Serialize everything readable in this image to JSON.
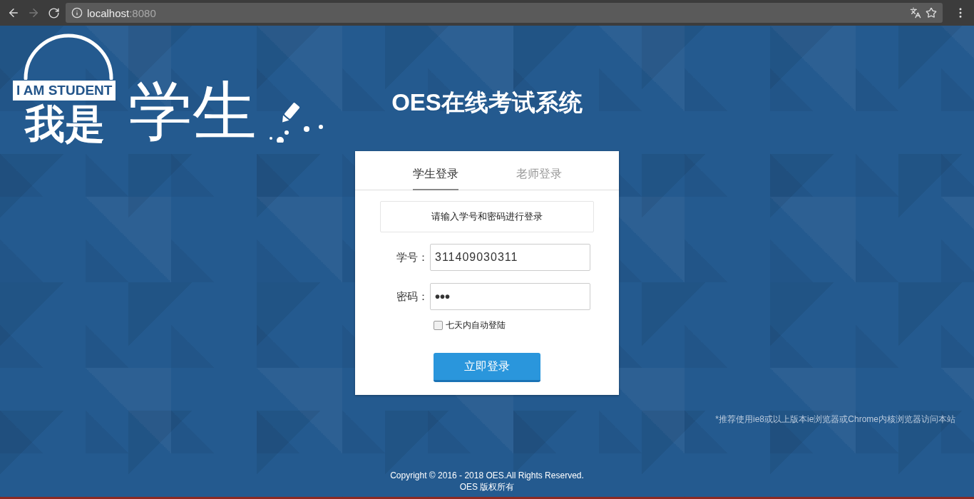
{
  "browser": {
    "url_host": "localhost",
    "url_port": ":8080"
  },
  "logo": {
    "badge": "I AM STUDENT",
    "line_bold": "我是",
    "line_light": "学生"
  },
  "title": "OES在线考试系统",
  "login": {
    "tabs": [
      {
        "label": "学生登录",
        "selected": true
      },
      {
        "label": "老师登录",
        "selected": false
      }
    ],
    "notice": "请输入学号和密码进行登录",
    "fields": [
      {
        "label": "学号：",
        "value": "311409030311",
        "kind": "text"
      },
      {
        "label": "密码：",
        "value": "•••",
        "kind": "password"
      }
    ],
    "remember": {
      "label": "七天内自动登陆",
      "checked": false
    },
    "submit": "立即登录"
  },
  "recommendation": "*推荐使用ie8或以上版本ie浏览器或Chrome内核浏览器访问本站",
  "footer": [
    "Copyright © 2016 - 2018 OES.All Rights Reserved.",
    "OES 版权所有"
  ]
}
